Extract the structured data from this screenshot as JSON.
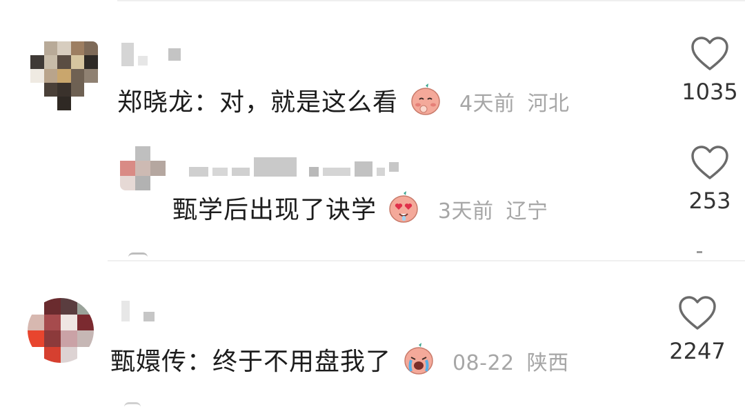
{
  "comments": [
    {
      "author": "郑晓龙",
      "separator": "：",
      "text": "对，就是这么看",
      "emoji": "blushing-face-emoji",
      "time": "4天前",
      "location": "河北",
      "likes": "1035"
    },
    {
      "author": "",
      "separator": "",
      "text": "甄学后出现了诀学",
      "emoji": "heart-eyes-face-emoji",
      "time": "3天前",
      "location": "辽宁",
      "likes": "253"
    },
    {
      "author": "甄嬛传",
      "separator": "：",
      "text": "终于不用盘我了",
      "emoji": "crying-face-emoji",
      "time": "08-22",
      "location": "陕西",
      "likes": "2247"
    }
  ],
  "icons": {
    "like": "heart-outline-icon"
  },
  "colors": {
    "meta_text": "#a6a6a6",
    "icon_stroke": "#6b6b6b",
    "emoji_face": "#f4a99a"
  }
}
